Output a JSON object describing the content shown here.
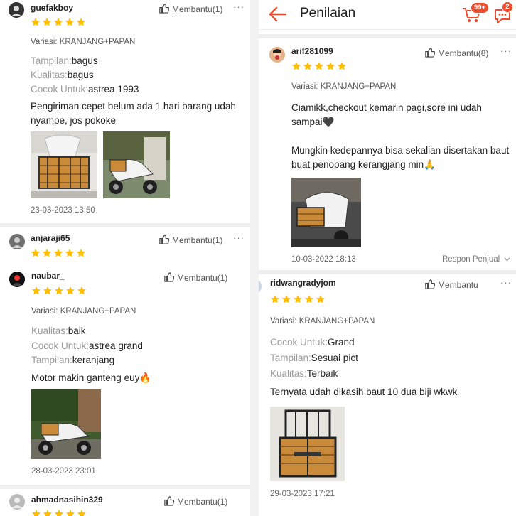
{
  "colors": {
    "accent": "#ee4d2d",
    "star": "#ffbf00"
  },
  "header": {
    "title": "Penilaian",
    "cart_badge": "99+",
    "chat_badge": "2"
  },
  "left": {
    "reviews": [
      {
        "username": "guefakboy",
        "rating": 5,
        "helpful": "Membantu(1)",
        "variant": "Variasi: KRANJANG+PAPAN",
        "attrs": [
          {
            "k": "Tampilan:",
            "v": "bagus"
          },
          {
            "k": "Kualitas:",
            "v": "bagus"
          },
          {
            "k": "Cocok Untuk:",
            "v": "astrea 1993"
          }
        ],
        "text": "Pengiriman cepet belum ada 1 hari barang udah nyampe, jos pokoke",
        "date": "23-03-2023 13:50"
      },
      {
        "username": "anjaraji65",
        "rating": 5,
        "helpful": "Membantu(1)"
      },
      {
        "username": "naubar_",
        "rating": 5,
        "helpful": "Membantu(1)",
        "variant": "Variasi: KRANJANG+PAPAN",
        "attrs": [
          {
            "k": "Kualitas:",
            "v": "baik"
          },
          {
            "k": "Cocok Untuk:",
            "v": "astrea grand"
          },
          {
            "k": "Tampilan:",
            "v": "keranjang"
          }
        ],
        "text": "Motor makin ganteng euy🔥",
        "date": "28-03-2023 23:01"
      },
      {
        "username": "ahmadnasihin329",
        "rating": 5,
        "helpful": "Membantu(1)"
      }
    ]
  },
  "right": {
    "reviews": [
      {
        "username": "arif281099",
        "rating": 5,
        "helpful": "Membantu(8)",
        "variant": "Variasi: KRANJANG+PAPAN",
        "text1": "Ciamikk,checkout kemarin pagi,sore ini udah sampai🖤",
        "text2": "Mungkin kedepannya bisa sekalian disertakan baut buat penopang kerangjang min🙏",
        "date": "10-03-2022 18:13",
        "seller_reply": "Respon Penjual"
      },
      {
        "username": "ridwangradyjom",
        "rating": 5,
        "helpful": "Membantu",
        "variant": "Variasi: KRANJANG+PAPAN",
        "attrs": [
          {
            "k": "Cocok Untuk:",
            "v": "Grand"
          },
          {
            "k": "Tampilan:",
            "v": "Sesuai pict"
          },
          {
            "k": "Kualitas:",
            "v": "Terbaik"
          }
        ],
        "text": "Ternyata udah dikasih baut 10 dua biji wkwk",
        "date": "29-03-2023 17:21"
      }
    ]
  }
}
